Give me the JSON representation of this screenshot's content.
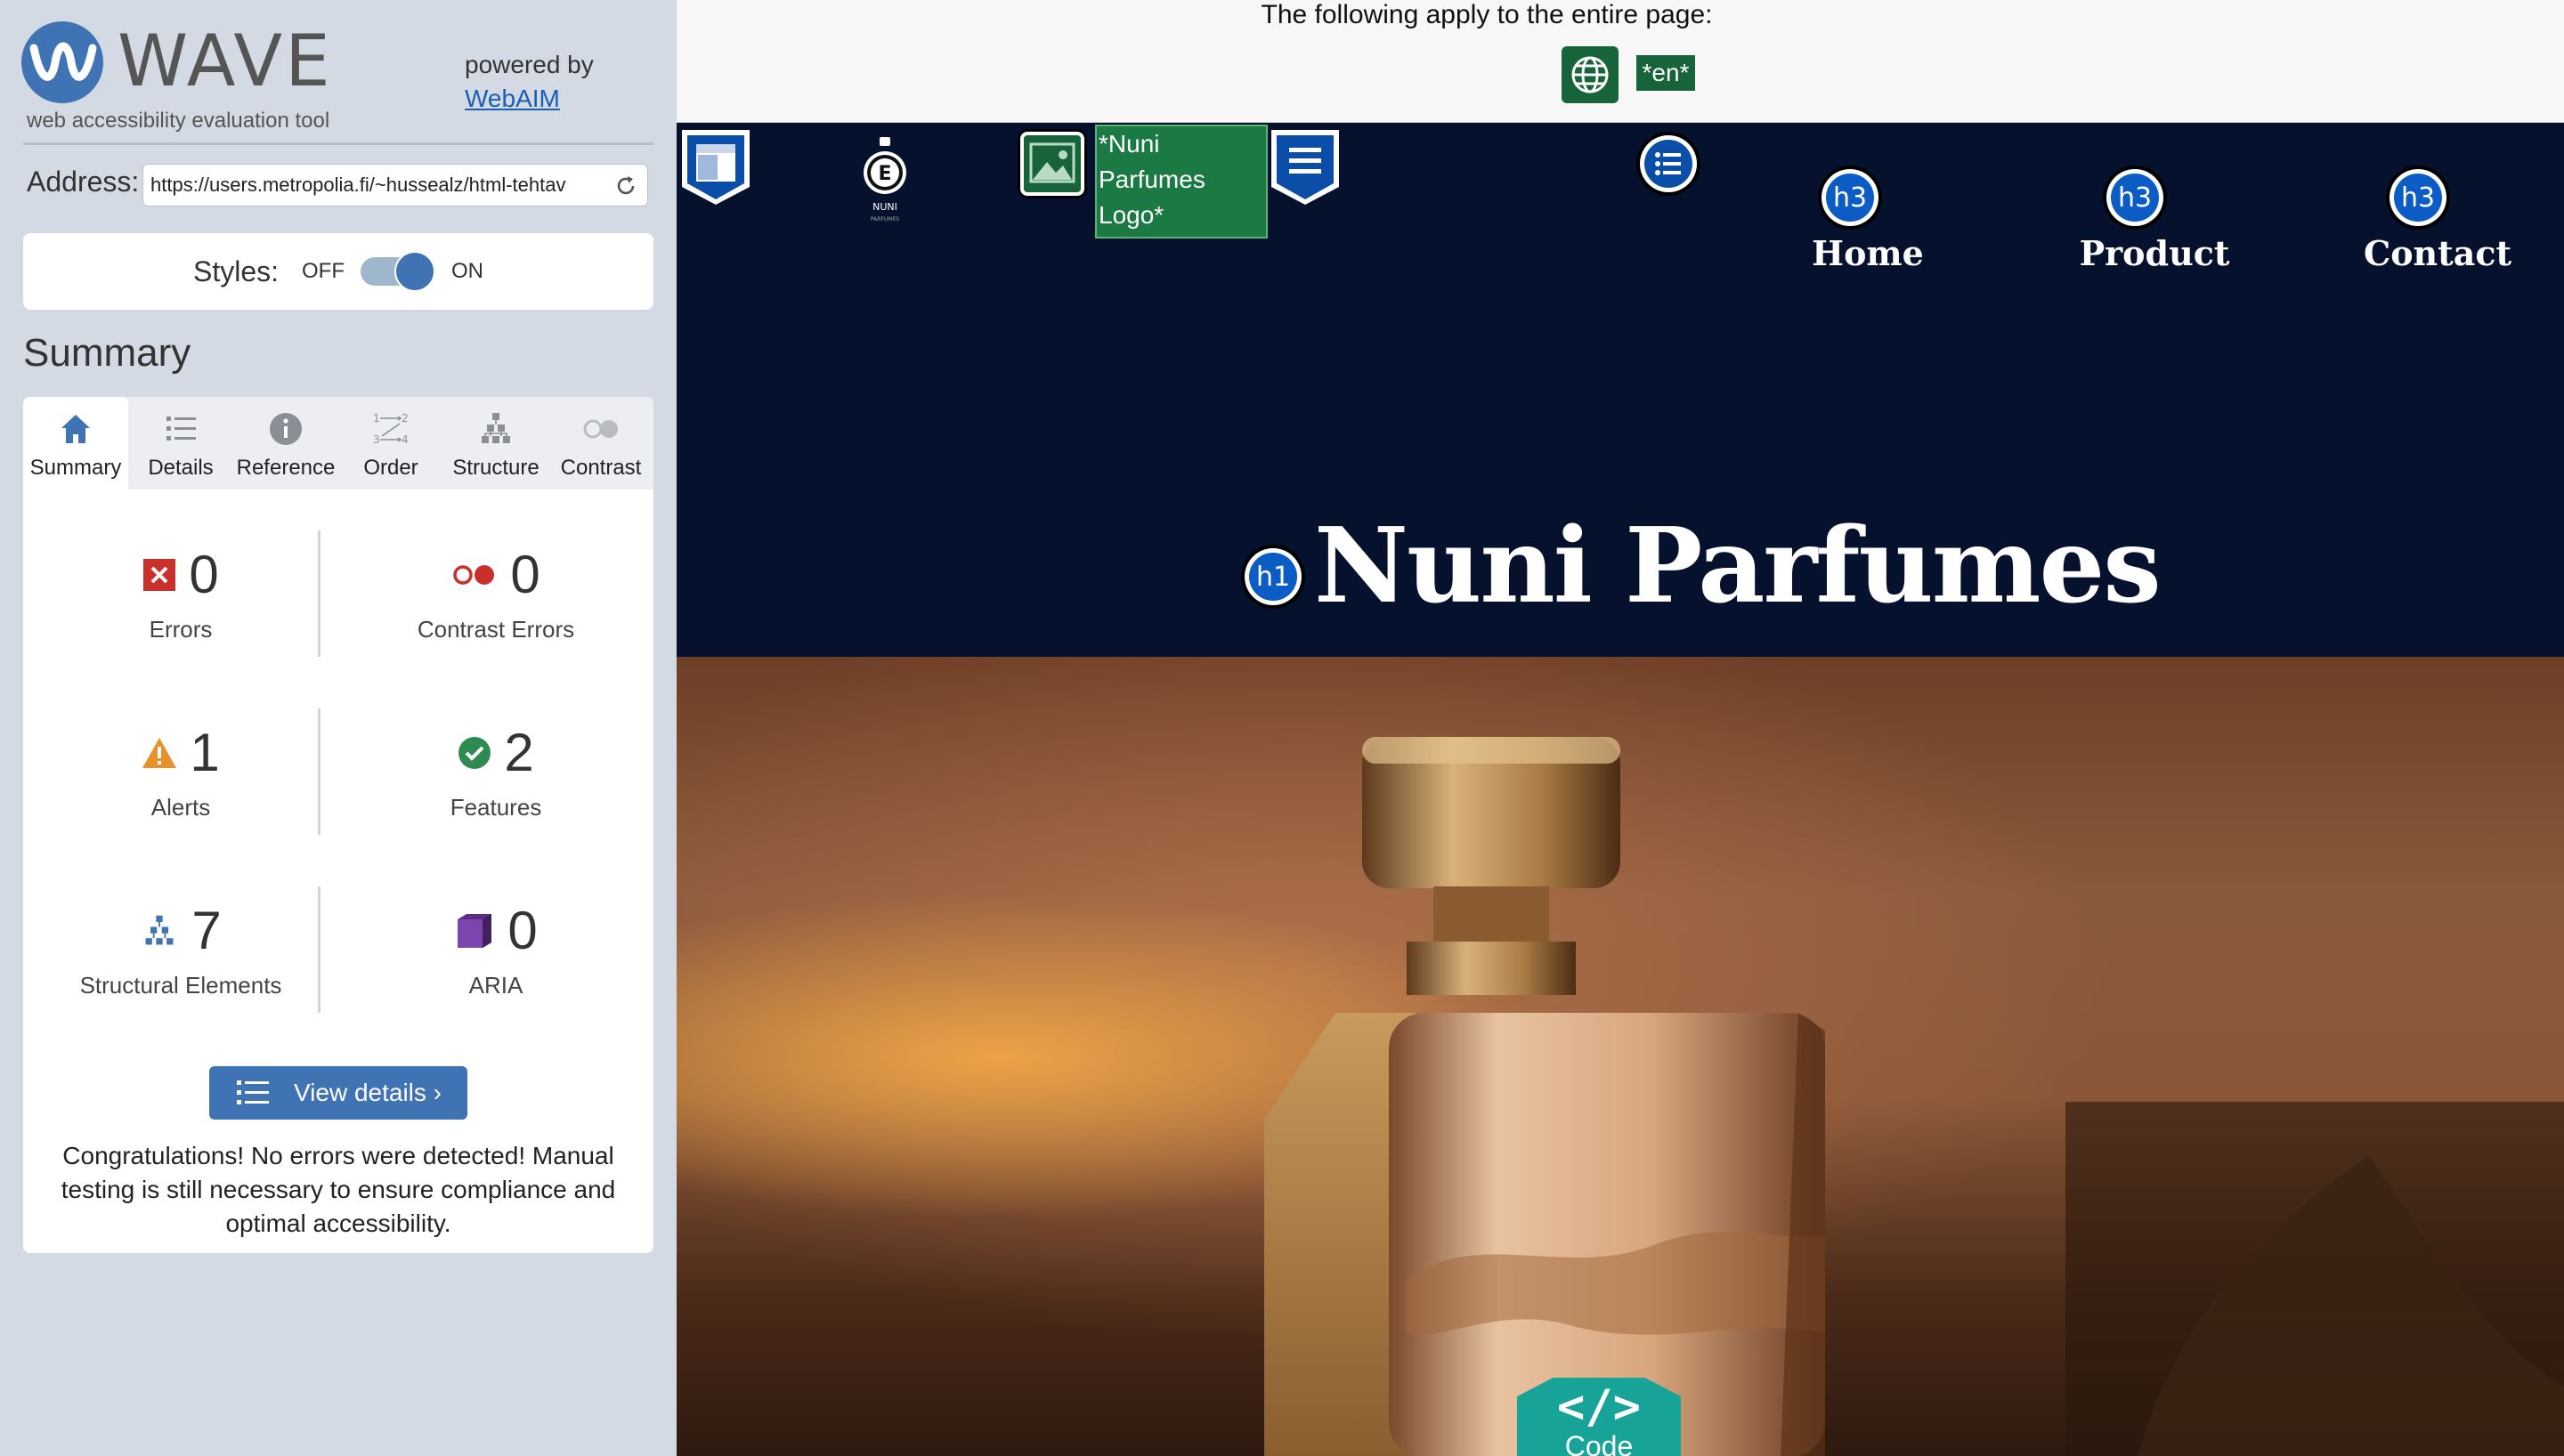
{
  "wave": {
    "logo_text": "WAVE",
    "tagline": "web accessibility evaluation tool",
    "powered_by": "powered by",
    "powered_link": "WebAIM",
    "address_label": "Address:",
    "address_value": "https://users.metropolia.fi/~hussealz/html-tehtav",
    "styles_label": "Styles:",
    "styles_off": "OFF",
    "styles_on": "ON",
    "styles_state": "on",
    "summary_title": "Summary",
    "tabs": [
      {
        "label": "Summary",
        "icon": "home-icon",
        "active": true
      },
      {
        "label": "Details",
        "icon": "list-icon",
        "active": false
      },
      {
        "label": "Reference",
        "icon": "info-icon",
        "active": false
      },
      {
        "label": "Order",
        "icon": "order-icon",
        "active": false
      },
      {
        "label": "Structure",
        "icon": "structure-icon",
        "active": false
      },
      {
        "label": "Contrast",
        "icon": "contrast-icon",
        "active": false
      }
    ],
    "stats": {
      "errors": {
        "value": "0",
        "label": "Errors"
      },
      "contrast_errors": {
        "value": "0",
        "label": "Contrast Errors"
      },
      "alerts": {
        "value": "1",
        "label": "Alerts"
      },
      "features": {
        "value": "2",
        "label": "Features"
      },
      "structural": {
        "value": "7",
        "label": "Structural Elements"
      },
      "aria": {
        "value": "0",
        "label": "ARIA"
      }
    },
    "view_details": "View details ›",
    "congrats": "Congratulations! No errors were detected! Manual testing is still necessary to ensure compliance and optimal accessibility.",
    "colors": {
      "accent": "#3f73b4",
      "sidebar_bg": "#d4dae3",
      "feature_green": "#17633a"
    }
  },
  "page": {
    "banner_text": "The following apply to the entire page:",
    "lang_badge": "*en*",
    "logo_alt": "*Nuni Parfumes Logo*",
    "brand_small": "NUNI",
    "brand_sub": "PARFUMES",
    "nav": [
      {
        "label": "Home",
        "badge": "h3"
      },
      {
        "label": "Product",
        "badge": "h3"
      },
      {
        "label": "Contact",
        "badge": "h3"
      }
    ],
    "h1_badge": "h1",
    "title": "Nuni Parfumes",
    "code_glyph": "</>",
    "code_label": "Code",
    "colors": {
      "header_bg": "#06112e",
      "code_tab": "#17a398"
    }
  }
}
